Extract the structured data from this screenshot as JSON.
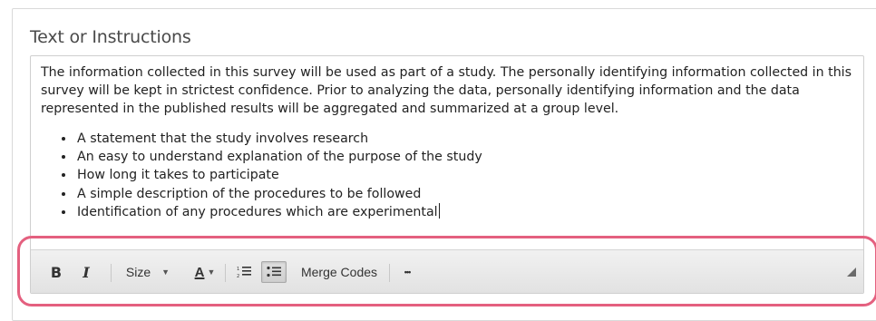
{
  "section": {
    "title": "Text or Instructions"
  },
  "editor": {
    "paragraph": "The information collected in this survey will be used as part of a study. The personally identifying information collected in this survey will be kept in strictest confidence. Prior to analyzing the data, personally identifying information and the data represented in the published results will be aggregated and summarized at a group level.",
    "bullets": [
      "A statement that the study involves research",
      "An easy to understand explanation of the purpose of the study",
      "How long it takes to participate",
      "A simple description of the procedures to be followed",
      "Identification of any procedures which are experimental"
    ]
  },
  "toolbar": {
    "bold_label": "B",
    "italic_label": "I",
    "size_label": "Size",
    "font_color_label": "A",
    "merge_codes_label": "Merge Codes",
    "more_label": "•••",
    "icons": {
      "numbered_list": "numbered-list-icon",
      "bulleted_list": "bulleted-list-icon",
      "resize": "resize-handle-icon"
    },
    "bulleted_list_active": true
  },
  "highlight": {
    "color": "#e4607f"
  }
}
